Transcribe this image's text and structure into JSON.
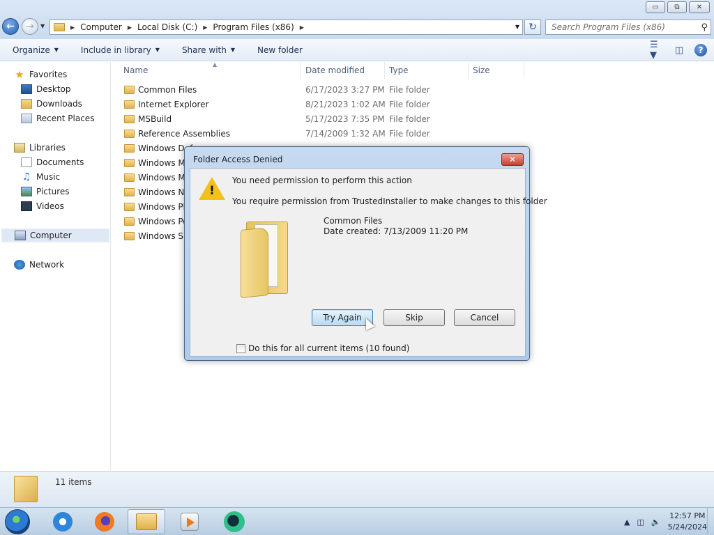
{
  "window": {
    "controls": {
      "minimize": "▭",
      "maximize": "⧉",
      "close": "✕"
    }
  },
  "nav": {
    "breadcrumbs": [
      "Computer",
      "Local Disk (C:)",
      "Program Files (x86)"
    ],
    "search_placeholder": "Search Program Files (x86)"
  },
  "toolbar": {
    "organize": "Organize",
    "include_in_library": "Include in library",
    "share_with": "Share with",
    "new_folder": "New folder"
  },
  "sidebar": {
    "favorites": "Favorites",
    "desktop": "Desktop",
    "downloads": "Downloads",
    "recent_places": "Recent Places",
    "libraries": "Libraries",
    "documents": "Documents",
    "music": "Music",
    "pictures": "Pictures",
    "videos": "Videos",
    "computer": "Computer",
    "network": "Network"
  },
  "columns": {
    "name": "Name",
    "date": "Date modified",
    "type": "Type",
    "size": "Size"
  },
  "files": [
    {
      "name": "Common Files",
      "date": "6/17/2023 3:27 PM",
      "type": "File folder"
    },
    {
      "name": "Internet Explorer",
      "date": "8/21/2023 1:02 AM",
      "type": "File folder"
    },
    {
      "name": "MSBuild",
      "date": "5/17/2023 7:35 PM",
      "type": "File folder"
    },
    {
      "name": "Reference Assemblies",
      "date": "7/14/2009 1:32 AM",
      "type": "File folder"
    },
    {
      "name": "Windows Def",
      "date": "",
      "type": ""
    },
    {
      "name": "Windows Ma",
      "date": "",
      "type": ""
    },
    {
      "name": "Windows Me",
      "date": "",
      "type": ""
    },
    {
      "name": "Windows NT",
      "date": "",
      "type": ""
    },
    {
      "name": "Windows Ph",
      "date": "",
      "type": ""
    },
    {
      "name": "Windows Po",
      "date": "",
      "type": ""
    },
    {
      "name": "Windows Sic",
      "date": "",
      "type": ""
    }
  ],
  "status": {
    "count": "11 items"
  },
  "dialog": {
    "title": "Folder Access Denied",
    "message": "You need permission to perform this action",
    "detail": "You require permission from TrustedInstaller to make changes to this folder",
    "file_name": "Common Files",
    "date_created": "Date created: 7/13/2009 11:20 PM",
    "try_again": "Try Again",
    "skip": "Skip",
    "cancel": "Cancel",
    "checkbox_label": "Do this for all current items (10 found)"
  },
  "taskbar": {
    "time": "12:57 PM",
    "date": "5/24/2024"
  }
}
